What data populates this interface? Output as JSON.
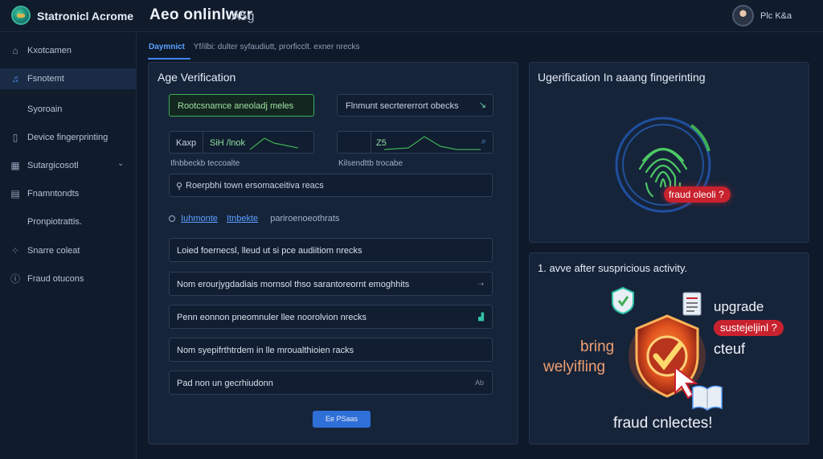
{
  "header": {
    "app_title": "Statronicl Acrome",
    "page_title": "Aeo onlinlwcr",
    "page_badge": "A5g",
    "user_name": "Plc K&a"
  },
  "sidebar": {
    "items": [
      {
        "label": "Kxotcamen",
        "icon": "home-icon"
      },
      {
        "label": "Fsnotemt",
        "icon": "person-icon",
        "active": true
      },
      {
        "label": "Syoroain",
        "icon": ""
      },
      {
        "label": "Device fingerprinting",
        "icon": "device-icon"
      },
      {
        "label": "Sutargicosotl",
        "icon": "grid-icon",
        "chevron": "⌄"
      },
      {
        "label": "Fnamntondts",
        "icon": "list-icon"
      },
      {
        "label": "Pronpiotrattis.",
        "icon": ""
      },
      {
        "label": "Snarre coleat",
        "icon": "share-icon"
      },
      {
        "label": "Fraud otucons",
        "icon": "info-icon"
      }
    ]
  },
  "breadcrumb": {
    "active": "Daymnict",
    "rest": "Yf/ilbi: dulter syfaudiutt, prorficclt. exner nrecks"
  },
  "form_panel": {
    "title": "Age Verification",
    "field1": "Rootcsnamce aneoladj meles",
    "field2": "Flnmunt secrtererrort obecks",
    "field3_prefix": "Kaxp",
    "field3_value": "SiH  /lnok",
    "field3_label": "Ifnbbeckb teccoalte",
    "field4_value": "Z5",
    "field4_label": "Kilsendttb trocabe",
    "field5": "Roerpbhi town ersomaceitiva reacs",
    "options": {
      "opt1": "Iuhmonte",
      "opt2": "Itnbekte",
      "opt3": "pariroenoeothrats"
    },
    "rows": [
      "Loied foernecsl, lleud ut si pce audiitiom nrecks",
      "Nom erourjygdadiais mornsol thso sarantoreornt emoghhits",
      "Penn eonnon pneomnuler llee noorolvion nrecks",
      "Nom syepifrthtrdem in lle mroualthioien racks",
      "Pad non un gecrhiudonn"
    ],
    "row_icons": [
      "",
      "⇢",
      "▟",
      "",
      "Ab"
    ],
    "submit_label": "Ee PSaas"
  },
  "fingerprint_panel": {
    "title": "Ugerification In aaang fingerinting",
    "badge": "fraud oleoli ?"
  },
  "activity_panel": {
    "title": "1. avve after suspricious activity.",
    "upgrade": "upgrade",
    "badge": "sustejeljinl ?",
    "cteuf": "cteuf",
    "bring": "bring",
    "welyifling": "welyifling",
    "footer": "fraud cnlectes!"
  },
  "colors": {
    "accent": "#3f86f0",
    "success": "#3fae55",
    "danger": "#c8222e",
    "background": "#0e1929",
    "panel": "#16243a"
  }
}
